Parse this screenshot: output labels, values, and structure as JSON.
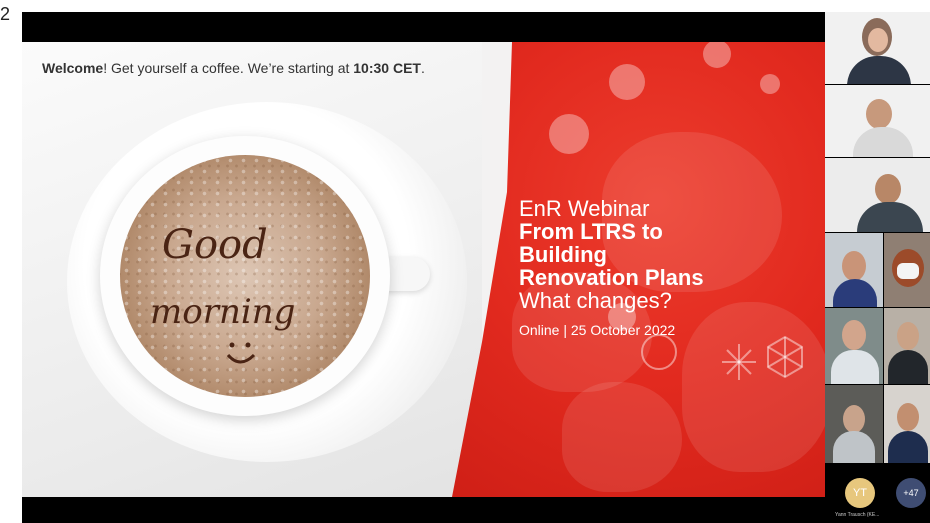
{
  "page_number": "2",
  "slide": {
    "welcome_bold": "Welcome",
    "welcome_middle": "! Get yourself a coffee. We’re starting at ",
    "welcome_time": "10:30 CET",
    "welcome_end": ".",
    "title_line1": "EnR Webinar",
    "title_line2": "From LTRS to",
    "title_line3": "Building",
    "title_line4": "Renovation Plans",
    "title_line5": "What changes?",
    "date": "Online | 25 October 2022",
    "cup_text_line1": "Good",
    "cup_text_line2": "morning",
    "accent_red": "#e22a1f"
  },
  "gallery": {
    "yt_initials": "YT",
    "yt_name": "Yann Trausch (KE...",
    "more_count": "+47"
  }
}
